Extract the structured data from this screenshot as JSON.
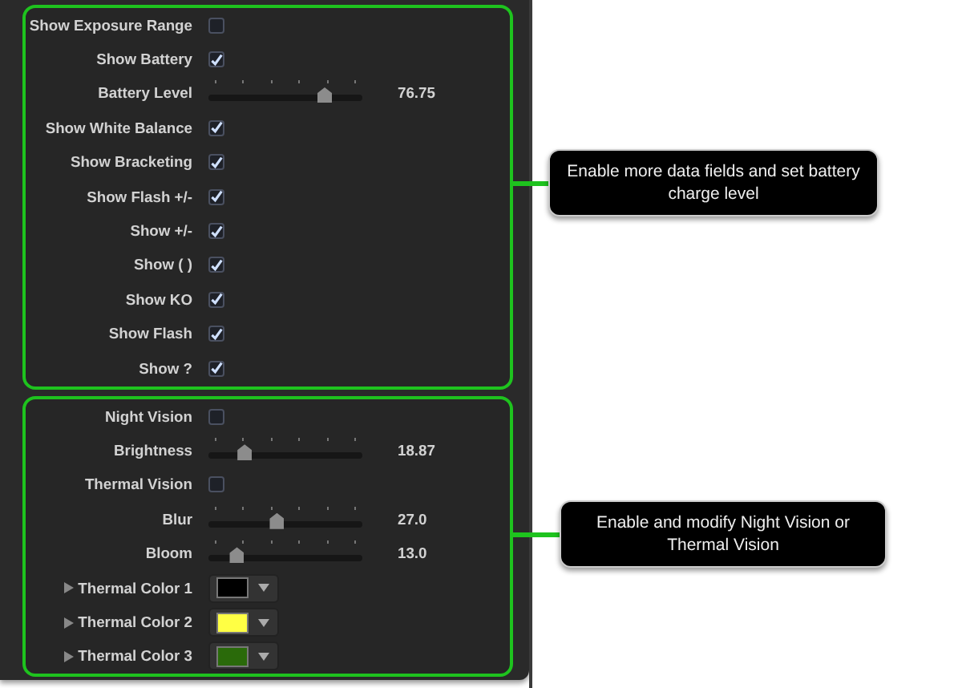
{
  "groups": [
    {
      "items": [
        {
          "kind": "checkbox",
          "label": "Show Exposure Range",
          "checked": false
        },
        {
          "kind": "checkbox",
          "label": "Show Battery",
          "checked": true
        },
        {
          "kind": "slider",
          "label": "Battery Level",
          "level": 0.75,
          "reading": "76.75"
        },
        {
          "kind": "checkbox",
          "label": "Show White Balance",
          "checked": true
        },
        {
          "kind": "checkbox",
          "label": "Show Bracketing",
          "checked": true
        },
        {
          "kind": "checkbox",
          "label": "Show Flash +/-",
          "checked": true
        },
        {
          "kind": "checkbox",
          "label": "Show +/-",
          "checked": true
        },
        {
          "kind": "checkbox",
          "label": "Show ( )",
          "checked": true
        },
        {
          "kind": "checkbox",
          "label": "Show KO",
          "checked": true
        },
        {
          "kind": "checkbox",
          "label": "Show Flash",
          "checked": true
        },
        {
          "kind": "checkbox",
          "label": "Show ?",
          "checked": true
        }
      ]
    },
    {
      "items": [
        {
          "kind": "checkbox",
          "label": "Night Vision",
          "checked": false
        },
        {
          "kind": "slider",
          "label": "Brightness",
          "level": 0.23,
          "reading": "18.87"
        },
        {
          "kind": "checkbox",
          "label": "Thermal Vision",
          "checked": false
        },
        {
          "kind": "slider",
          "label": "Blur",
          "level": 0.44,
          "reading": "27.0"
        },
        {
          "kind": "slider",
          "label": "Bloom",
          "level": 0.18,
          "reading": "13.0"
        },
        {
          "kind": "color",
          "label": "Thermal Color 1",
          "color": "#000000",
          "expanded": false
        },
        {
          "kind": "color",
          "label": "Thermal Color 2",
          "color": "#ffff44",
          "expanded": false
        },
        {
          "kind": "color",
          "label": "Thermal Color 3",
          "color": "#2a6a0a",
          "expanded": false
        }
      ]
    }
  ],
  "callouts": [
    {
      "text": "Enable more data fields and set battery charge level"
    },
    {
      "text": "Enable and modify Night Vision or Thermal Vision"
    }
  ]
}
